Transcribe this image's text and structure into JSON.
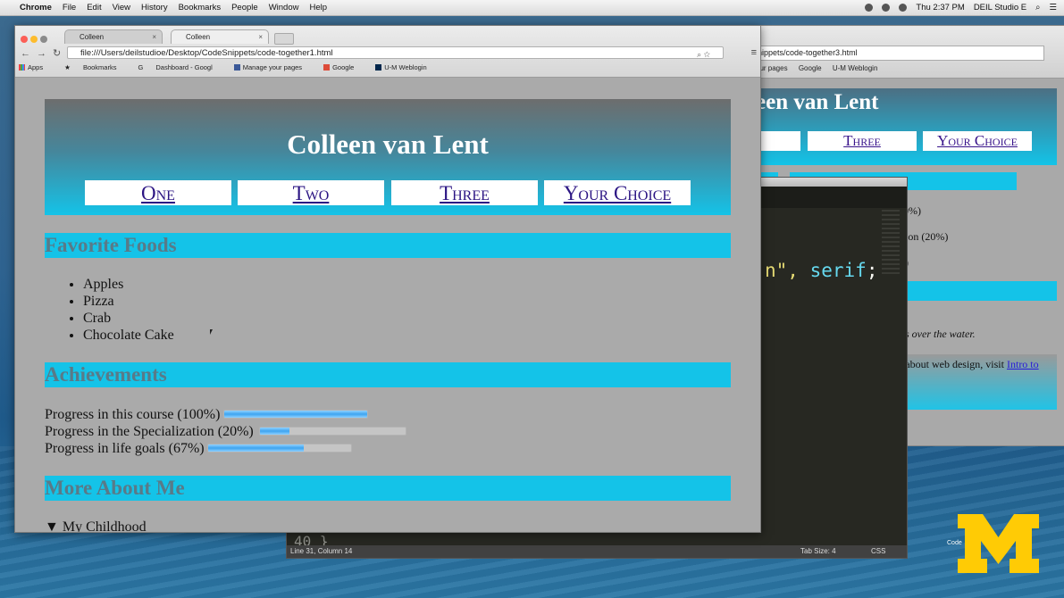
{
  "menubar": {
    "app": "Chrome",
    "items": [
      "File",
      "Edit",
      "View",
      "History",
      "Bookmarks",
      "People",
      "Window",
      "Help"
    ],
    "clock": "Thu 2:37 PM",
    "user": "DEIL Studio E"
  },
  "browser": {
    "tabs": [
      {
        "label": "Colleen",
        "active": false
      },
      {
        "label": "Colleen",
        "active": true
      }
    ],
    "url": "file:///Users/deilstudioe/Desktop/CodeSnippets/code-together1.html",
    "bookmarks": [
      "Apps",
      "Bookmarks",
      "Dashboard - Googl",
      "Manage your pages",
      "Google",
      "U-M Weblogin"
    ]
  },
  "page": {
    "name": "Colleen van Lent",
    "nav": [
      "One",
      "Two",
      "Three",
      "Your Choice"
    ],
    "sections": {
      "foods": "Favorite Foods",
      "achievements": "Achievements",
      "more": "More About Me"
    },
    "foods": [
      "Apples",
      "Pizza",
      "Crab",
      "Chocolate Cake"
    ],
    "progress": [
      {
        "label": "Progress in this course (100%)",
        "value": 1.0
      },
      {
        "label": "Progress in the Specialization (20%)",
        "value": 0.2
      },
      {
        "label": "Progress in life goals (67%)",
        "value": 0.67
      }
    ],
    "details": "▼ My Childhood"
  },
  "back_window": {
    "url": "nippets/code-together3.html",
    "bookmarks": [
      "our pages",
      "Google",
      "U-M Weblogin"
    ],
    "name": "een van Lent",
    "nav": [
      "Three",
      "Your Choice"
    ],
    "texts": [
      "0%)",
      "ion (20%)",
      ")"
    ],
    "italic": "s over the water.",
    "footer_text": "re about web design, visit",
    "footer_link": "Intro to"
  },
  "editor": {
    "code_string": "n\",",
    "code_keyword": "serif",
    "code_end": ";",
    "line_number": "40  }",
    "status_left": "Line 31, Column 14",
    "tab_size": "Tab Size: 4",
    "syntax": "CSS"
  },
  "overlay": {
    "code_label": "Code"
  },
  "colors": {
    "accent": "#14c3e8",
    "nav_link": "#2b1483",
    "um_maize": "#ffcb05"
  }
}
